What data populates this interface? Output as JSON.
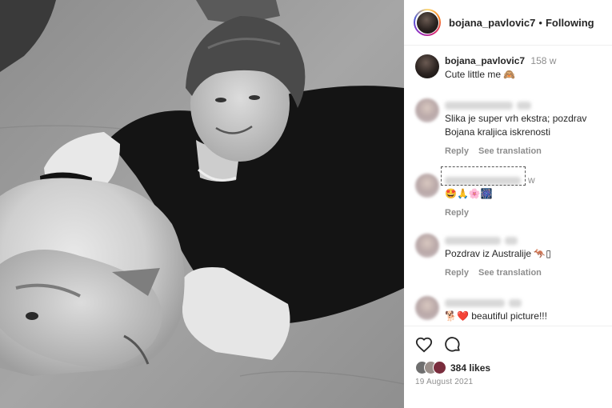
{
  "header": {
    "username": "bojana_pavlovic7",
    "separator": "•",
    "follow_status": "Following"
  },
  "caption": {
    "username": "bojana_pavlovic7",
    "time": "158 w",
    "text": "Cute little me 🙈"
  },
  "comments": [
    {
      "text": "Slika je super vrh ekstra; pozdrav Bojana kraljica iskrenosti",
      "reply_label": "Reply",
      "translate_label": "See translation"
    },
    {
      "time_tail": "w",
      "text": "🤩🙏🌸🎆",
      "reply_label": "Reply"
    },
    {
      "text": "Pozdrav iz Australije 🦘▯",
      "reply_label": "Reply",
      "translate_label": "See translation"
    },
    {
      "text": "🐕❤️ beautiful picture!!!"
    }
  ],
  "likes": {
    "count_text": "384 likes"
  },
  "post_date": "19 August 2021",
  "icons": {
    "like": "heart-icon",
    "comment": "comment-icon"
  },
  "colors": {
    "text": "#262626",
    "muted": "#8e8e8e",
    "divider": "#efefef"
  }
}
